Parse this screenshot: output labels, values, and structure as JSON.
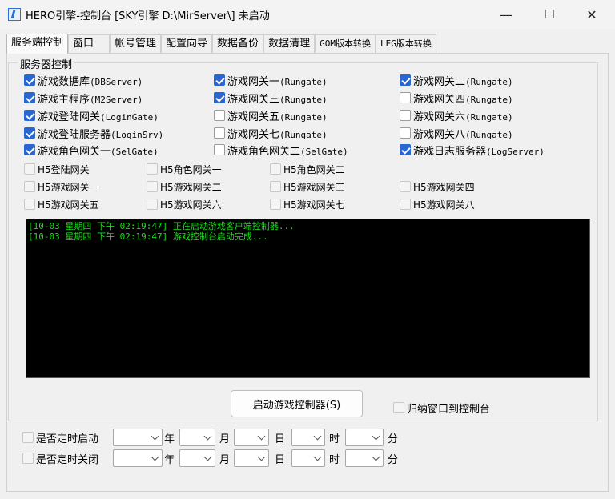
{
  "window": {
    "title": "HERO引擎-控制台 [SKY引擎 D:\\MirServer\\] 未启动",
    "minimize": "—",
    "maximize": "☐",
    "close": "✕"
  },
  "tabs": [
    {
      "label": "服务端控制",
      "active": true
    },
    {
      "label": "窗口"
    },
    {
      "label": "帐号管理"
    },
    {
      "label": "配置向导"
    },
    {
      "label": "数据备份"
    },
    {
      "label": "数据清理"
    },
    {
      "label": "GOM版本转换"
    },
    {
      "label": "LEG版本转换"
    }
  ],
  "server_group": {
    "title": "服务器控制",
    "checkboxes": [
      {
        "label": "游戏数据库",
        "sub": "(DBServer)",
        "checked": true
      },
      {
        "label": "游戏网关一",
        "sub": "(Rungate)",
        "checked": true
      },
      {
        "label": "游戏网关二",
        "sub": "(Rungate)",
        "checked": true
      },
      {
        "label": "游戏主程序",
        "sub": "(M2Server)",
        "checked": true
      },
      {
        "label": "游戏网关三",
        "sub": "(Rungate)",
        "checked": true
      },
      {
        "label": "游戏网关四",
        "sub": "(Rungate)",
        "checked": false
      },
      {
        "label": "游戏登陆网关",
        "sub": "(LoginGate)",
        "checked": true
      },
      {
        "label": "游戏网关五",
        "sub": "(Rungate)",
        "checked": false
      },
      {
        "label": "游戏网关六",
        "sub": "(Rungate)",
        "checked": false
      },
      {
        "label": "游戏登陆服务器",
        "sub": "(LoginSrv)",
        "checked": true
      },
      {
        "label": "游戏网关七",
        "sub": "(Rungate)",
        "checked": false
      },
      {
        "label": "游戏网关八",
        "sub": "(Rungate)",
        "checked": false
      },
      {
        "label": "游戏角色网关一",
        "sub": "(SelGate)",
        "checked": true
      },
      {
        "label": "游戏角色网关二",
        "sub": "(SelGate)",
        "checked": false
      },
      {
        "label": "游戏日志服务器",
        "sub": "(LogServer)",
        "checked": true
      }
    ],
    "h5_checkboxes": [
      {
        "label": "H5登陆网关"
      },
      {
        "label": "H5角色网关一"
      },
      {
        "label": "H5角色网关二"
      },
      {
        "label": "H5游戏网关一"
      },
      {
        "label": "H5游戏网关二"
      },
      {
        "label": "H5游戏网关三"
      },
      {
        "label": "H5游戏网关四"
      },
      {
        "label": "H5游戏网关五"
      },
      {
        "label": "H5游戏网关六"
      },
      {
        "label": "H5游戏网关七"
      },
      {
        "label": "H5游戏网关八"
      }
    ]
  },
  "console": {
    "lines": [
      "[10-03 星期四 下午 02:19:47] 正在启动游戏客户端控制器...",
      "[10-03 星期四 下午 02:19:47] 游戏控制台启动完成..."
    ]
  },
  "start_button": "启动游戏控制器(S)",
  "minimize_to_console": "归纳窗口到控制台",
  "schedule": {
    "start_label": "是否定时启动",
    "stop_label": "是否定时关闭",
    "year": "年",
    "month": "月",
    "day": "日",
    "hour": "时",
    "minute": "分"
  },
  "colors": {
    "accent": "#2867d3",
    "console_bg": "#000000",
    "console_text": "#18e018"
  }
}
